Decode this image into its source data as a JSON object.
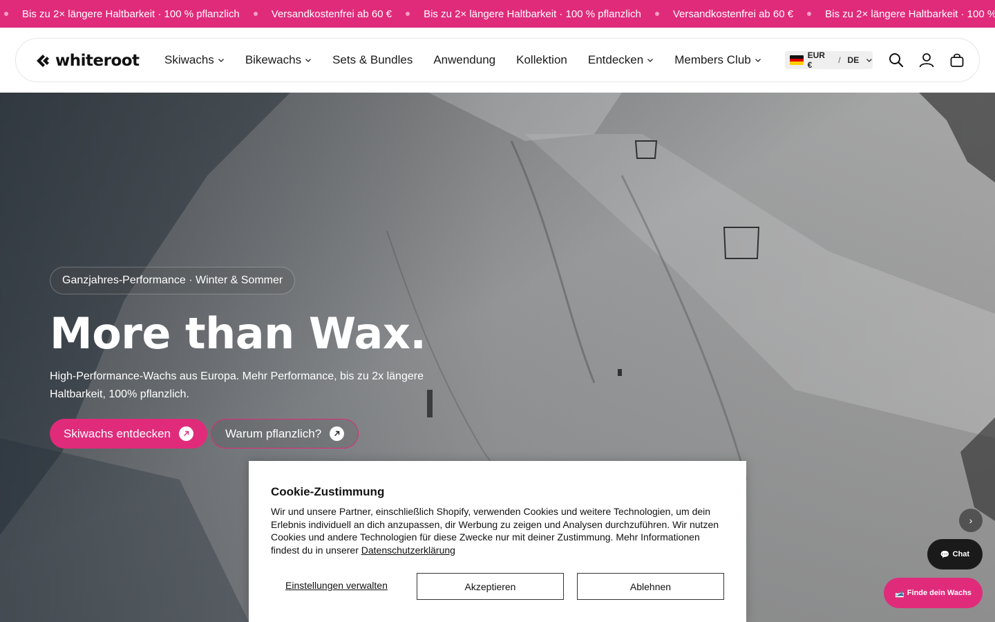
{
  "announcement": {
    "items": [
      "Bis zu 2× längere Haltbarkeit · 100 % pflanzlich",
      "Versandkostenfrei ab 60 €",
      "Bis zu 2× längere Haltbarkeit · 100 % pflanzlich",
      "Versandkostenfrei ab 60 €",
      "Bis zu 2× längere Haltbarkeit · 100 % pflanzlich"
    ]
  },
  "header": {
    "logo_text": "whiteroot",
    "nav": [
      {
        "label": "Skiwachs",
        "has_dropdown": true
      },
      {
        "label": "Bikewachs",
        "has_dropdown": true
      },
      {
        "label": "Sets & Bundles",
        "has_dropdown": false
      },
      {
        "label": "Anwendung",
        "has_dropdown": false
      },
      {
        "label": "Kollektion",
        "has_dropdown": false
      },
      {
        "label": "Entdecken",
        "has_dropdown": true
      },
      {
        "label": "Members Club",
        "has_dropdown": true
      }
    ],
    "locale": {
      "currency": "EUR €",
      "separator": "/",
      "language": "DE"
    },
    "icons": [
      "search-icon",
      "account-icon",
      "cart-icon"
    ]
  },
  "hero": {
    "badge": "Ganzjahres-Performance · Winter & Sommer",
    "title": "More than Wax.",
    "subtitle": "High-Performance-Wachs aus Europa. Mehr Performance, bis zu 2x längere Haltbarkeit, 100% pflanzlich.",
    "primary_button": "Skiwachs entdecken",
    "secondary_button": "Warum pflanzlich?",
    "next_label": "›"
  },
  "floating": {
    "chat_label": "Chat",
    "finder_label": "Finde dein Wachs"
  },
  "cookie": {
    "title": "Cookie-Zustimmung",
    "text": "Wir und unsere Partner, einschließlich Shopify, verwenden Cookies und weitere Technologien, um dein Erlebnis individuell an dich anzupassen, dir Werbung zu zeigen und Analysen durchzuführen. Wir nutzen Cookies und andere Technologien für diese Zwecke nur mit deiner Zustimmung. Mehr Informationen findest du in unserer",
    "link": "Datenschutzerklärung",
    "settings": "Einstellungen verwalten",
    "accept": "Akzeptieren",
    "decline": "Ablehnen"
  },
  "colors": {
    "brand_pink": "#e02b7b",
    "dark": "#1a1a1a"
  }
}
